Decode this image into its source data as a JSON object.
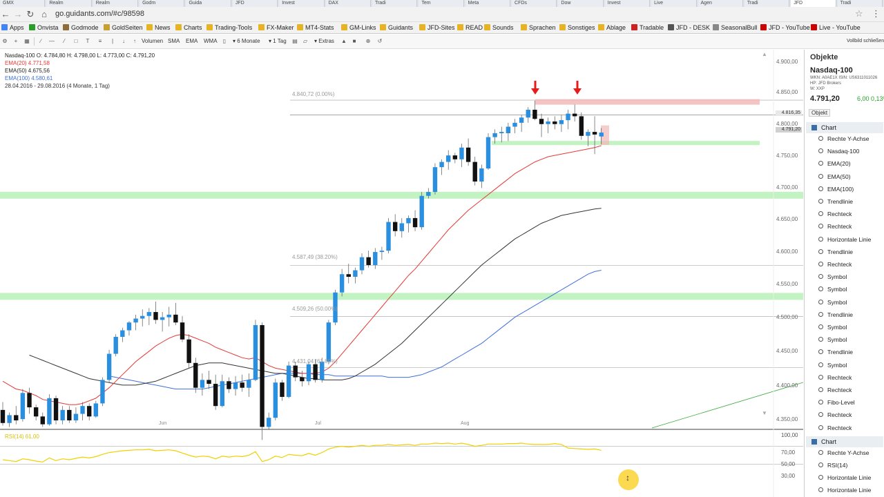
{
  "browser": {
    "tabs": [
      "GMX",
      "Realm",
      "Realm",
      "Godm",
      "Guida",
      "JFD",
      "Invest",
      "DAX",
      "Tradi",
      "Tem",
      "Meta",
      "CFDs",
      "Dow",
      "Invest",
      "Live",
      "Agen",
      "Tradi",
      "JFD",
      "Tradi"
    ],
    "url": "go.guidants.com/#c/98598",
    "back_icon": "arrow-left-icon",
    "forward_icon": "arrow-right-icon",
    "reload_icon": "reload-icon",
    "home_icon": "home-icon"
  },
  "bookmarks": [
    {
      "label": "Apps",
      "color": "#4285f4"
    },
    {
      "label": "Onvista",
      "color": "#2a9d2a"
    },
    {
      "label": "Godmode",
      "color": "#8d6e3a"
    },
    {
      "label": "GoldSeiten",
      "color": "#c8a032"
    },
    {
      "label": "News",
      "color": "#e6b422"
    },
    {
      "label": "Charts",
      "color": "#e6b422"
    },
    {
      "label": "Trading-Tools",
      "color": "#e6b422"
    },
    {
      "label": "FX-Maker",
      "color": "#e6b422"
    },
    {
      "label": "MT4-Stats",
      "color": "#e6b422"
    },
    {
      "label": "GM-Links",
      "color": "#e6b422"
    },
    {
      "label": "Guidants",
      "color": "#e6b422"
    },
    {
      "label": "JFD-Sites",
      "color": "#e6b422"
    },
    {
      "label": "READ",
      "color": "#e6b422"
    },
    {
      "label": "Sounds",
      "color": "#e6b422"
    },
    {
      "label": "Sprachen",
      "color": "#e6b422"
    },
    {
      "label": "Sonstiges",
      "color": "#e6b422"
    },
    {
      "label": "Ablage",
      "color": "#e6b422"
    },
    {
      "label": "Tradable",
      "color": "#cc2222"
    },
    {
      "label": "JFD - DESK",
      "color": "#555555"
    },
    {
      "label": "SeasonalBull",
      "color": "#888888"
    },
    {
      "label": "JFD - YouTube",
      "color": "#cc0000"
    },
    {
      "label": "Live - YouTube",
      "color": "#cc0000"
    }
  ],
  "toolbar": {
    "buttons": [
      "Volumen",
      "SMA",
      "EMA",
      "WMA"
    ],
    "period": "6 Monate",
    "interval": "1 Tag",
    "extras": "Extras",
    "fullscreen": "Vollbild schließen"
  },
  "chart": {
    "legend": {
      "title": "Nasdaq-100  O: 4.784,80  H: 4.798,00  L: 4.773,00  C: 4.791,20",
      "ema20": "EMA(20)  4.771,58",
      "ema50": "EMA(50)  4.675,56",
      "ema100": "EMA(100)  4.580,61",
      "range": "28.04.2016 - 29.08.2016 (4 Monate, 1 Tag)"
    },
    "y_labels": [
      "4.900,00",
      "4.850,00",
      "4.800,00",
      "4.750,00",
      "4.700,00",
      "4.650,00",
      "4.600,00",
      "4.550,00",
      "4.500,00",
      "4.450,00",
      "4.400,00",
      "4.350,00"
    ],
    "price_tags": [
      "4.816,35",
      "4.791,20"
    ],
    "x_labels": [
      "Jun",
      "Jul",
      "Aug"
    ],
    "fibo_levels": [
      "4.840,72 (0.00%)",
      "4.587,49 (38.20%)",
      "4.509,26 (50.00%)",
      "4.431,04 (61.80%)"
    ],
    "rsi_label": "RSI(14)  61,00",
    "rsi_scale": [
      "100,00",
      "70,00",
      "50,00",
      "30,00"
    ],
    "colors": {
      "bull": "#2b8fe0",
      "bear": "#111111",
      "ema20": "#e53935",
      "ema50": "#333333",
      "ema100": "#3f6fd8",
      "rsi": "#f0d000",
      "zone_green": "#b8f0b8",
      "zone_red": "#f2b8b8",
      "arrow": "#e51c1c"
    }
  },
  "chart_data": {
    "type": "candlestick",
    "ylim": [
      4340,
      4910
    ],
    "candles": [
      {
        "o": 4366,
        "h": 4378,
        "l": 4342,
        "c": 4346
      },
      {
        "o": 4346,
        "h": 4362,
        "l": 4340,
        "c": 4358
      },
      {
        "o": 4358,
        "h": 4372,
        "l": 4344,
        "c": 4350
      },
      {
        "o": 4352,
        "h": 4398,
        "l": 4348,
        "c": 4392
      },
      {
        "o": 4392,
        "h": 4400,
        "l": 4360,
        "c": 4370
      },
      {
        "o": 4370,
        "h": 4374,
        "l": 4350,
        "c": 4356
      },
      {
        "o": 4356,
        "h": 4362,
        "l": 4340,
        "c": 4344
      },
      {
        "o": 4344,
        "h": 4390,
        "l": 4342,
        "c": 4384
      },
      {
        "o": 4384,
        "h": 4388,
        "l": 4344,
        "c": 4350
      },
      {
        "o": 4350,
        "h": 4372,
        "l": 4344,
        "c": 4366
      },
      {
        "o": 4366,
        "h": 4372,
        "l": 4346,
        "c": 4350
      },
      {
        "o": 4350,
        "h": 4370,
        "l": 4346,
        "c": 4360
      },
      {
        "o": 4360,
        "h": 4378,
        "l": 4350,
        "c": 4372
      },
      {
        "o": 4372,
        "h": 4376,
        "l": 4350,
        "c": 4356
      },
      {
        "o": 4356,
        "h": 4380,
        "l": 4354,
        "c": 4376
      },
      {
        "o": 4376,
        "h": 4416,
        "l": 4372,
        "c": 4412
      },
      {
        "o": 4412,
        "h": 4458,
        "l": 4408,
        "c": 4452
      },
      {
        "o": 4452,
        "h": 4482,
        "l": 4448,
        "c": 4478
      },
      {
        "o": 4478,
        "h": 4492,
        "l": 4470,
        "c": 4488
      },
      {
        "o": 4488,
        "h": 4502,
        "l": 4480,
        "c": 4500
      },
      {
        "o": 4500,
        "h": 4512,
        "l": 4488,
        "c": 4506
      },
      {
        "o": 4506,
        "h": 4520,
        "l": 4494,
        "c": 4510
      },
      {
        "o": 4510,
        "h": 4522,
        "l": 4496,
        "c": 4516
      },
      {
        "o": 4516,
        "h": 4532,
        "l": 4498,
        "c": 4504
      },
      {
        "o": 4504,
        "h": 4516,
        "l": 4486,
        "c": 4508
      },
      {
        "o": 4508,
        "h": 4524,
        "l": 4494,
        "c": 4512
      },
      {
        "o": 4512,
        "h": 4530,
        "l": 4496,
        "c": 4500
      },
      {
        "o": 4500,
        "h": 4510,
        "l": 4470,
        "c": 4474
      },
      {
        "o": 4474,
        "h": 4482,
        "l": 4430,
        "c": 4438
      },
      {
        "o": 4438,
        "h": 4446,
        "l": 4392,
        "c": 4400
      },
      {
        "o": 4400,
        "h": 4422,
        "l": 4388,
        "c": 4412
      },
      {
        "o": 4412,
        "h": 4426,
        "l": 4398,
        "c": 4406
      },
      {
        "o": 4406,
        "h": 4420,
        "l": 4366,
        "c": 4372
      },
      {
        "o": 4372,
        "h": 4420,
        "l": 4370,
        "c": 4410
      },
      {
        "o": 4410,
        "h": 4416,
        "l": 4392,
        "c": 4398
      },
      {
        "o": 4398,
        "h": 4418,
        "l": 4388,
        "c": 4408
      },
      {
        "o": 4408,
        "h": 4420,
        "l": 4394,
        "c": 4400
      },
      {
        "o": 4400,
        "h": 4422,
        "l": 4386,
        "c": 4412
      },
      {
        "o": 4412,
        "h": 4504,
        "l": 4410,
        "c": 4496
      },
      {
        "o": 4496,
        "h": 4500,
        "l": 4320,
        "c": 4340
      },
      {
        "o": 4340,
        "h": 4362,
        "l": 4336,
        "c": 4354
      },
      {
        "o": 4354,
        "h": 4414,
        "l": 4350,
        "c": 4408
      },
      {
        "o": 4408,
        "h": 4412,
        "l": 4380,
        "c": 4386
      },
      {
        "o": 4386,
        "h": 4440,
        "l": 4384,
        "c": 4434
      },
      {
        "o": 4434,
        "h": 4440,
        "l": 4410,
        "c": 4416
      },
      {
        "o": 4416,
        "h": 4426,
        "l": 4402,
        "c": 4410
      },
      {
        "o": 4410,
        "h": 4440,
        "l": 4404,
        "c": 4436
      },
      {
        "o": 4436,
        "h": 4444,
        "l": 4408,
        "c": 4412
      },
      {
        "o": 4412,
        "h": 4446,
        "l": 4408,
        "c": 4440
      },
      {
        "o": 4440,
        "h": 4504,
        "l": 4436,
        "c": 4500
      },
      {
        "o": 4500,
        "h": 4550,
        "l": 4496,
        "c": 4546
      },
      {
        "o": 4546,
        "h": 4582,
        "l": 4540,
        "c": 4574
      },
      {
        "o": 4574,
        "h": 4590,
        "l": 4560,
        "c": 4570
      },
      {
        "o": 4570,
        "h": 4584,
        "l": 4560,
        "c": 4580
      },
      {
        "o": 4580,
        "h": 4606,
        "l": 4574,
        "c": 4600
      },
      {
        "o": 4600,
        "h": 4610,
        "l": 4584,
        "c": 4588
      },
      {
        "o": 4588,
        "h": 4614,
        "l": 4582,
        "c": 4608
      },
      {
        "o": 4608,
        "h": 4616,
        "l": 4596,
        "c": 4610
      },
      {
        "o": 4610,
        "h": 4660,
        "l": 4606,
        "c": 4654
      },
      {
        "o": 4654,
        "h": 4666,
        "l": 4632,
        "c": 4640
      },
      {
        "o": 4640,
        "h": 4660,
        "l": 4630,
        "c": 4652
      },
      {
        "o": 4652,
        "h": 4664,
        "l": 4638,
        "c": 4660
      },
      {
        "o": 4660,
        "h": 4672,
        "l": 4640,
        "c": 4646
      },
      {
        "o": 4646,
        "h": 4700,
        "l": 4642,
        "c": 4694
      },
      {
        "o": 4694,
        "h": 4706,
        "l": 4690,
        "c": 4700
      },
      {
        "o": 4700,
        "h": 4744,
        "l": 4696,
        "c": 4738
      },
      {
        "o": 4738,
        "h": 4750,
        "l": 4726,
        "c": 4746
      },
      {
        "o": 4746,
        "h": 4764,
        "l": 4734,
        "c": 4756
      },
      {
        "o": 4756,
        "h": 4760,
        "l": 4744,
        "c": 4750
      },
      {
        "o": 4750,
        "h": 4774,
        "l": 4738,
        "c": 4768
      },
      {
        "o": 4768,
        "h": 4782,
        "l": 4740,
        "c": 4746
      },
      {
        "o": 4746,
        "h": 4754,
        "l": 4710,
        "c": 4716
      },
      {
        "o": 4716,
        "h": 4742,
        "l": 4706,
        "c": 4736
      },
      {
        "o": 4736,
        "h": 4790,
        "l": 4734,
        "c": 4784
      },
      {
        "o": 4784,
        "h": 4796,
        "l": 4774,
        "c": 4790
      },
      {
        "o": 4790,
        "h": 4800,
        "l": 4776,
        "c": 4792
      },
      {
        "o": 4790,
        "h": 4806,
        "l": 4778,
        "c": 4800
      },
      {
        "o": 4800,
        "h": 4812,
        "l": 4790,
        "c": 4806
      },
      {
        "o": 4806,
        "h": 4818,
        "l": 4792,
        "c": 4814
      },
      {
        "o": 4814,
        "h": 4830,
        "l": 4806,
        "c": 4826
      },
      {
        "o": 4826,
        "h": 4840,
        "l": 4810,
        "c": 4812
      },
      {
        "o": 4812,
        "h": 4820,
        "l": 4784,
        "c": 4804
      },
      {
        "o": 4804,
        "h": 4814,
        "l": 4790,
        "c": 4808
      },
      {
        "o": 4808,
        "h": 4816,
        "l": 4796,
        "c": 4804
      },
      {
        "o": 4804,
        "h": 4818,
        "l": 4792,
        "c": 4810
      },
      {
        "o": 4810,
        "h": 4826,
        "l": 4796,
        "c": 4820
      },
      {
        "o": 4820,
        "h": 4834,
        "l": 4808,
        "c": 4816
      },
      {
        "o": 4816,
        "h": 4822,
        "l": 4780,
        "c": 4786
      },
      {
        "o": 4786,
        "h": 4796,
        "l": 4770,
        "c": 4792
      },
      {
        "o": 4792,
        "h": 4816,
        "l": 4758,
        "c": 4788
      },
      {
        "o": 4785,
        "h": 4798,
        "l": 4773,
        "c": 4791
      }
    ],
    "ema20": [
      4410,
      4404,
      4398,
      4396,
      4392,
      4388,
      4382,
      4380,
      4378,
      4376,
      4374,
      4374,
      4376,
      4380,
      4384,
      4392,
      4400,
      4410,
      4420,
      4430,
      4440,
      4448,
      4456,
      4464,
      4470,
      4476,
      4480,
      4482,
      4480,
      4476,
      4472,
      4468,
      4462,
      4458,
      4454,
      4450,
      4446,
      4444,
      4446,
      4440,
      4434,
      4430,
      4428,
      4426,
      4424,
      4422,
      4422,
      4422,
      4424,
      4430,
      4440,
      4452,
      4464,
      4476,
      4488,
      4500,
      4512,
      4524,
      4536,
      4548,
      4560,
      4572,
      4582,
      4594,
      4606,
      4618,
      4630,
      4642,
      4652,
      4662,
      4672,
      4680,
      4688,
      4696,
      4704,
      4712,
      4720,
      4728,
      4734,
      4740,
      4746,
      4750,
      4754,
      4756,
      4758,
      4760,
      4762,
      4764,
      4766,
      4768,
      4771
    ],
    "ema50": [
      4450,
      4446,
      4442,
      4438,
      4434,
      4430,
      4426,
      4422,
      4418,
      4414,
      4412,
      4410,
      4408,
      4406,
      4404,
      4404,
      4404,
      4406,
      4408,
      4410,
      4414,
      4418,
      4422,
      4426,
      4430,
      4434,
      4436,
      4438,
      4438,
      4438,
      4436,
      4434,
      4432,
      4430,
      4428,
      4426,
      4424,
      4422,
      4422,
      4420,
      4418,
      4416,
      4414,
      4414,
      4412,
      4412,
      4412,
      4412,
      4414,
      4418,
      4424,
      4430,
      4436,
      4444,
      4452,
      4460,
      4468,
      4478,
      4488,
      4498,
      4508,
      4518,
      4528,
      4538,
      4548,
      4558,
      4568,
      4578,
      4588,
      4596,
      4604,
      4612,
      4620,
      4628,
      4634,
      4640,
      4646,
      4652,
      4656,
      4660,
      4664,
      4666,
      4668,
      4670,
      4672,
      4674,
      4675
    ],
    "ema100": [
      4418,
      4416,
      4414,
      4412,
      4410,
      4408,
      4406,
      4404,
      4402,
      4400,
      4398,
      4398,
      4398,
      4398,
      4398,
      4400,
      4402,
      4404,
      4406,
      4408,
      4410,
      4412,
      4414,
      4416,
      4418,
      4420,
      4422,
      4422,
      4422,
      4422,
      4422,
      4420,
      4420,
      4420,
      4418,
      4418,
      4418,
      4418,
      4418,
      4418,
      4418,
      4418,
      4416,
      4416,
      4416,
      4416,
      4418,
      4420,
      4424,
      4428,
      4432,
      4438,
      4444,
      4450,
      4456,
      4462,
      4468,
      4476,
      4484,
      4492,
      4500,
      4508,
      4514,
      4520,
      4526,
      4532,
      4538,
      4544,
      4550,
      4556,
      4562,
      4568,
      4574,
      4578,
      4580
    ],
    "rsi": [
      40,
      38,
      36,
      42,
      40,
      37,
      35,
      44,
      38,
      42,
      40,
      43,
      46,
      44,
      47,
      52,
      56,
      58,
      60,
      61,
      62,
      62,
      63,
      60,
      61,
      62,
      60,
      55,
      50,
      46,
      48,
      47,
      42,
      48,
      46,
      48,
      47,
      50,
      58,
      36,
      40,
      48,
      45,
      52,
      50,
      49,
      54,
      50,
      56,
      64,
      68,
      70,
      68,
      70,
      72,
      70,
      72,
      72,
      74,
      72,
      73,
      74,
      72,
      75,
      75,
      77,
      76,
      77,
      75,
      77,
      74,
      70,
      72,
      75,
      75,
      75,
      76,
      76,
      77,
      75,
      74,
      74,
      74,
      76,
      74,
      66,
      65,
      64,
      63,
      64,
      61
    ]
  },
  "panel": {
    "title": "Objekte",
    "instrument": "Nasdaq-100",
    "meta1": "WKN: A0AE1X  ISIN: US6311011026",
    "meta2": "HP: JFD Brokers",
    "meta3": "W: XXP",
    "price": "4.791,20",
    "change": "6,00  0,13%",
    "objekt_tab": "Objekt",
    "group1": "Chart",
    "items1": [
      "Rechte Y-Achse",
      "Nasdaq-100",
      "EMA(20)",
      "EMA(50)",
      "EMA(100)",
      "Trendlinie",
      "Rechteck",
      "Rechteck",
      "Horizontale Linie",
      "Trendlinie",
      "Rechteck",
      "Symbol",
      "Symbol",
      "Symbol",
      "Trendlinie",
      "Symbol",
      "Symbol",
      "Trendlinie",
      "Symbol",
      "Rechteck",
      "Rechteck",
      "Fibo-Level",
      "Rechteck",
      "Rechteck"
    ],
    "group2": "Chart",
    "items2": [
      "Rechte Y-Achse",
      "RSI(14)",
      "Horizontale Linie",
      "Horizontale Linie"
    ]
  }
}
